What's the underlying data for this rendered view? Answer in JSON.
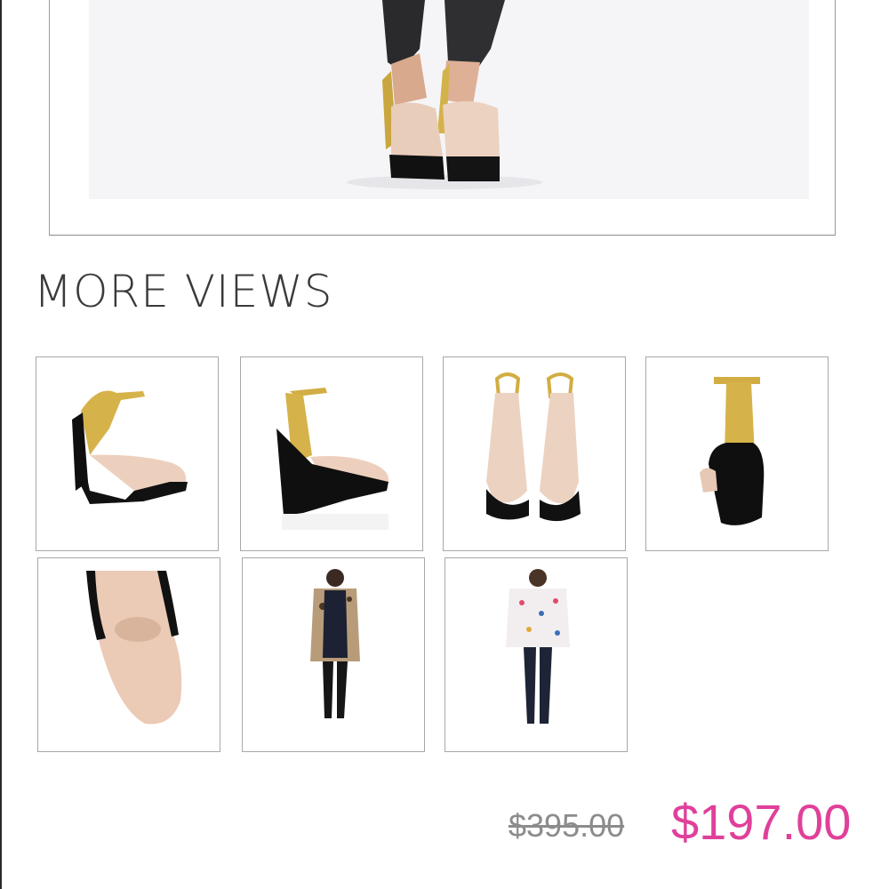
{
  "more_views": {
    "title": "MORE VIEWS",
    "thumbnails": [
      {
        "name": "shoe-view-angled"
      },
      {
        "name": "shoe-view-side"
      },
      {
        "name": "shoe-view-front-pair"
      },
      {
        "name": "shoe-view-back"
      },
      {
        "name": "shoe-view-toe-closeup"
      },
      {
        "name": "outfit-view-leopard-coat"
      },
      {
        "name": "outfit-view-polka-top"
      }
    ]
  },
  "price": {
    "original": "$395.00",
    "sale": "$197.00"
  },
  "colors": {
    "sale_price": "#e0409a",
    "original_price": "#8c8c8c",
    "title": "#3a3a3a"
  }
}
